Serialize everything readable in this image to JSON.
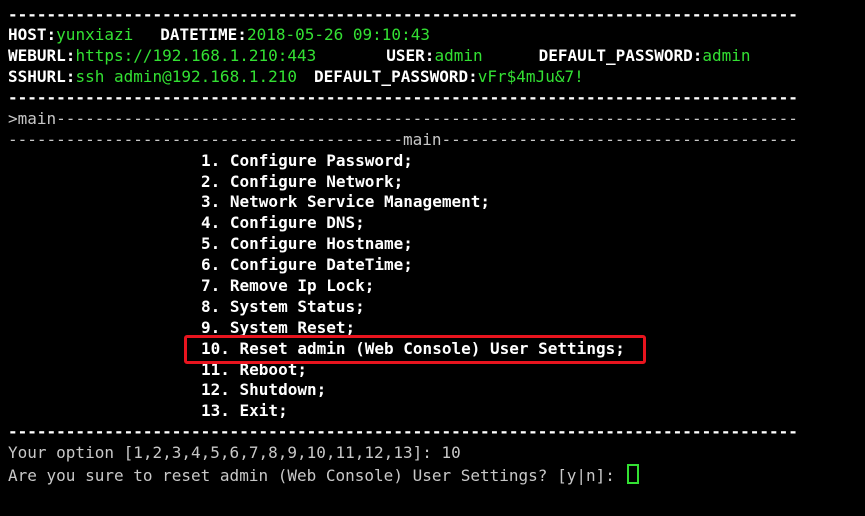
{
  "header": {
    "host_label": "HOST:",
    "host_value": "yunxiazi",
    "datetime_label": "DATETIME:",
    "datetime_value": "2018-05-26 09:10:43",
    "weburl_label": "WEBURL:",
    "weburl_value": "https://192.168.1.210:443",
    "user_label": "USER:",
    "user_value": "admin",
    "web_default_password_label": "DEFAULT_PASSWORD:",
    "web_default_password_value": "admin",
    "sshurl_label": "SSHURL:",
    "sshurl_value": "ssh admin@192.168.1.210",
    "ssh_default_password_label": "DEFAULT_PASSWORD:",
    "ssh_default_password_value": "vFr$4mJu&7!"
  },
  "breadcrumb": ">main",
  "menu_title": "main",
  "menu_items": [
    "1. Configure Password;",
    "2. Configure Network;",
    "3. Network Service Management;",
    "4. Configure DNS;",
    "5. Configure Hostname;",
    "6. Configure DateTime;",
    "7. Remove Ip Lock;",
    "8. System Status;",
    "9. System Reset;",
    "10. Reset admin (Web Console) User Settings;",
    "11. Reboot;",
    "12. Shutdown;",
    "13. Exit;"
  ],
  "prompt": {
    "option_text": "Your option [1,2,3,4,5,6,7,8,9,10,11,12,13]: 10",
    "confirm_text": "Are you sure to reset admin (Web Console) User Settings? [y|n]: "
  },
  "colors": {
    "background": "#000000",
    "text": "#ffffff",
    "value_green": "#33e033",
    "highlight_red": "#e8141e"
  }
}
